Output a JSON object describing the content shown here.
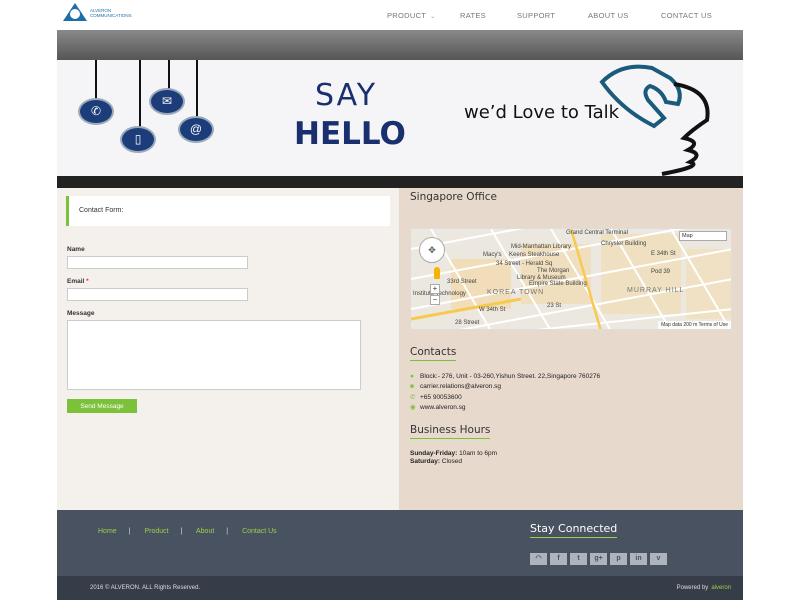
{
  "logo": {
    "text": "ALVERON COMMUNICATIONS"
  },
  "nav": {
    "items": [
      {
        "label": "PRODUCT",
        "has_dropdown": true
      },
      {
        "label": "RATES"
      },
      {
        "label": "SUPPORT"
      },
      {
        "label": "ABOUT US"
      },
      {
        "label": "CONTACT US"
      }
    ]
  },
  "banner": {
    "say": "SAY",
    "hello": "HELLO",
    "tagline": "we’d Love to Talk"
  },
  "form": {
    "title": "Contact Form:",
    "name_label": "Name",
    "email_label": "Email",
    "required_mark": "*",
    "message_label": "Message",
    "send_label": "Send Message"
  },
  "office": {
    "title": "Singapore Office",
    "map": {
      "type_select": "Map",
      "labels": [
        "Grand Central Terminal",
        "Mid-Manhattan Library",
        "Chrysler Building",
        "Macy's",
        "Keens Steakhouse",
        "34 Street - Herald Sq",
        "The Morgan Library & Museum",
        "Pod 39",
        "Empire State Building",
        "KOREA TOWN",
        "MURRAY HILL",
        "33rd Street",
        "23 St",
        "28 Street",
        "Institute Technology",
        "W 34th St",
        "E 34th St"
      ],
      "footer": "Map data   200 m     Terms of Use"
    }
  },
  "contacts": {
    "title": "Contacts",
    "address": "Block:- 276, Unit - 03-260,Yishun Street. 22,Singapore 760276",
    "email": "carrier.relations@alveron.sg",
    "phone": "+65 90053600",
    "website": "www.alveron.sg"
  },
  "hours": {
    "title": "Business Hours",
    "weekday_label": "Sunday-Friday:",
    "weekday_value": "10am to 6pm",
    "saturday_label": "Saturday:",
    "saturday_value": "Closed"
  },
  "footer": {
    "links": [
      "Home",
      "Product",
      "About",
      "Contact Us"
    ],
    "stay_connected": "Stay Connected",
    "social": [
      "rss-icon",
      "facebook-icon",
      "twitter-icon",
      "google-plus-icon",
      "pinterest-icon",
      "linkedin-icon",
      "vimeo-icon"
    ],
    "copyright": "2016 © ALVERON. ALL Rights Reserved.",
    "powered_label": "Powered by",
    "powered_brand": "alveron"
  },
  "colors": {
    "accent": "#7cc13a",
    "brand": "#1a2f6e",
    "footer": "#495260"
  }
}
